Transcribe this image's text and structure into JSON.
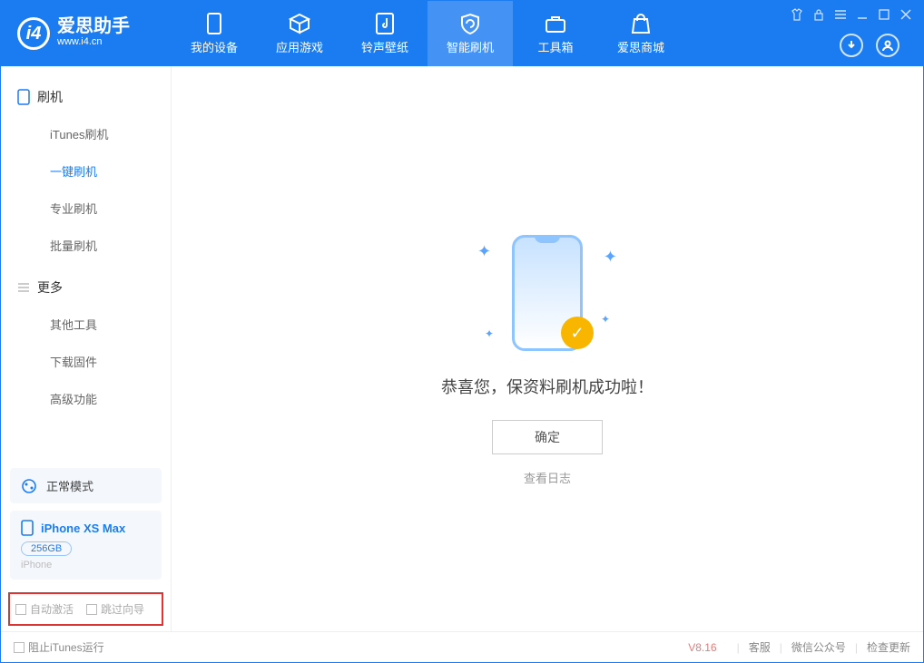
{
  "app": {
    "name": "爱思助手",
    "url": "www.i4.cn"
  },
  "tabs": [
    {
      "label": "我的设备"
    },
    {
      "label": "应用游戏"
    },
    {
      "label": "铃声壁纸"
    },
    {
      "label": "智能刷机"
    },
    {
      "label": "工具箱"
    },
    {
      "label": "爱思商城"
    }
  ],
  "sidebar": {
    "group1_title": "刷机",
    "group1_items": [
      "iTunes刷机",
      "一键刷机",
      "专业刷机",
      "批量刷机"
    ],
    "group2_title": "更多",
    "group2_items": [
      "其他工具",
      "下载固件",
      "高级功能"
    ]
  },
  "mode": {
    "label": "正常模式"
  },
  "device": {
    "name": "iPhone XS Max",
    "capacity": "256GB",
    "type": "iPhone"
  },
  "options": {
    "auto_activate": "自动激活",
    "skip_wizard": "跳过向导"
  },
  "main": {
    "message": "恭喜您，保资料刷机成功啦！",
    "ok": "确定",
    "view_log": "查看日志"
  },
  "status": {
    "stop_itunes": "阻止iTunes运行",
    "version": "V8.16",
    "links": [
      "客服",
      "微信公众号",
      "检查更新"
    ]
  }
}
